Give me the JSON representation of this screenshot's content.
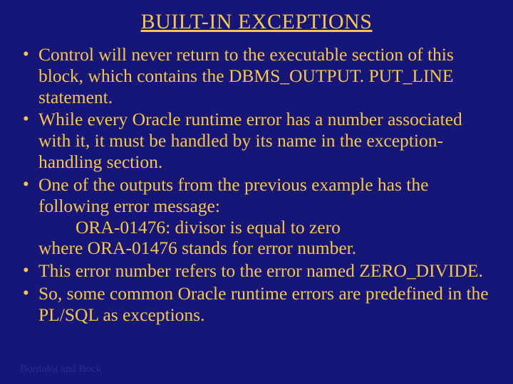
{
  "title": "BUILT-IN EXCEPTIONS",
  "bullets": {
    "b1": "Control will never return to the executable section of this block, which contains the DBMS_OUTPUT. PUT_LINE statement.",
    "b2": "While every Oracle runtime error has a number associated with it, it must be handled by its name in the exception-handling section.",
    "b3a": "One of the outputs from the previous example has the following error message:",
    "b3b": "ORA-01476: divisor is equal to zero",
    "b3c": "where ORA-01476 stands for error number.",
    "b4": "This error number refers to the error named ZERO_DIVIDE.",
    "b5": "So, some common Oracle runtime errors are predefined in the PL/SQL as exceptions."
  },
  "footer": "Bordoloi and Bock"
}
